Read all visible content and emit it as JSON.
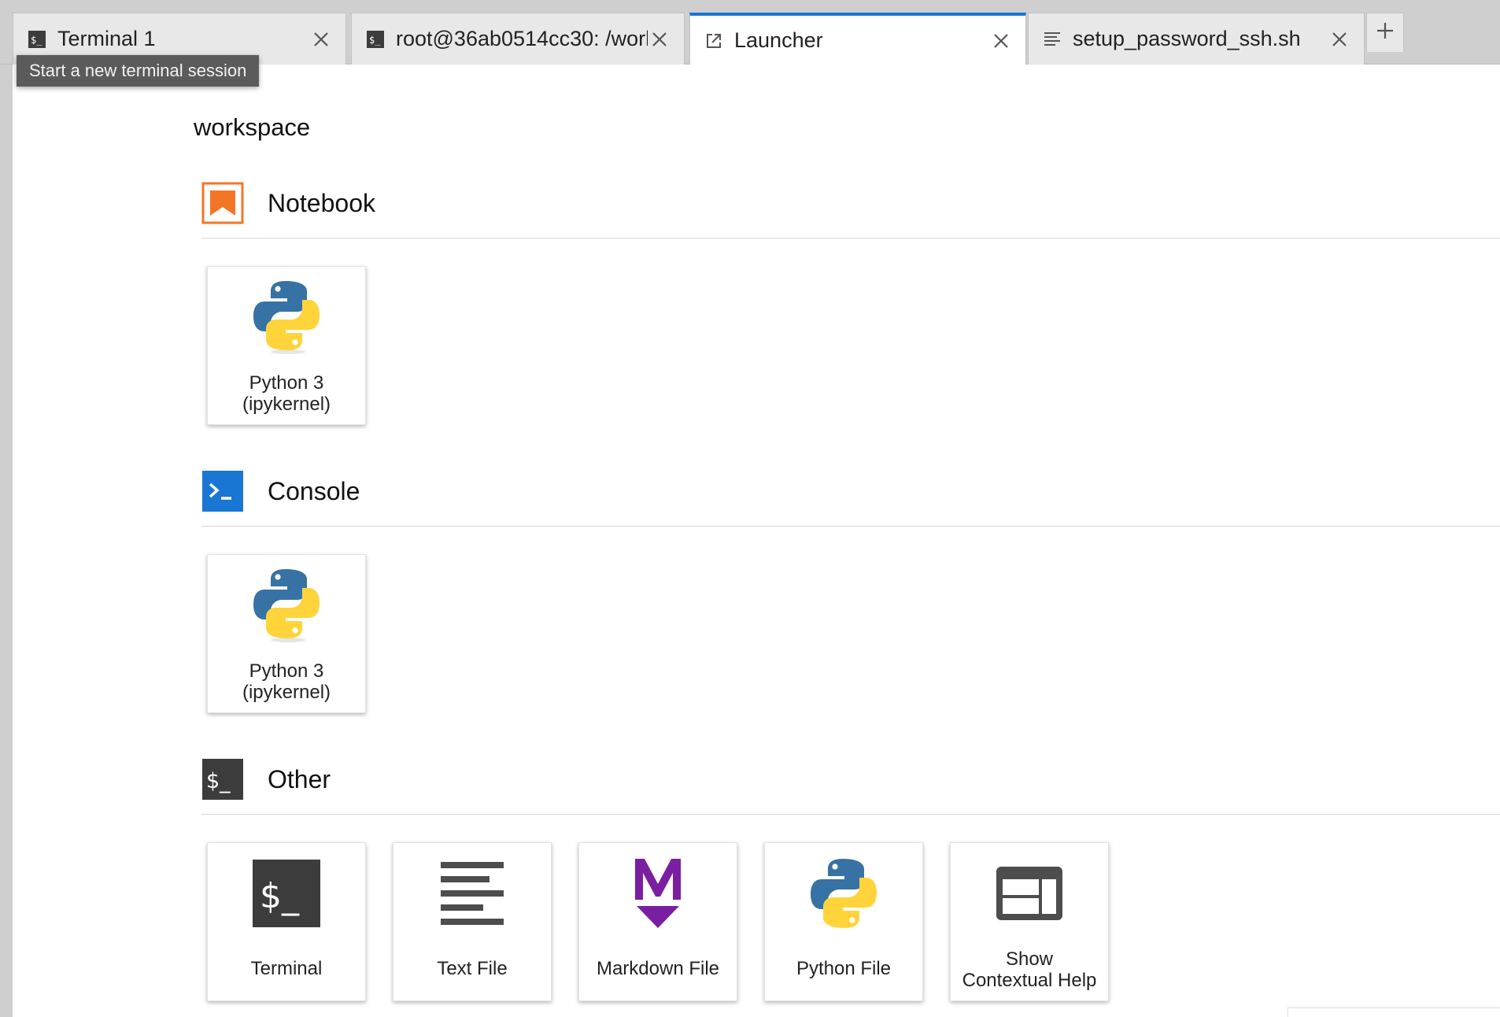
{
  "tabs": [
    {
      "label": "Terminal 1",
      "icon": "terminal-icon",
      "active": false
    },
    {
      "label": "root@36ab0514cc30: /worl",
      "icon": "terminal-icon",
      "active": false
    },
    {
      "label": "Launcher",
      "icon": "launch-icon",
      "active": true
    },
    {
      "label": "setup_password_ssh.sh",
      "icon": "text-file-icon",
      "active": false
    }
  ],
  "tooltip": "Start a new terminal session",
  "launcher": {
    "workspace": "workspace",
    "sections": {
      "notebook": {
        "title": "Notebook",
        "icon": "notebook-icon",
        "items": [
          {
            "label_line1": "Python 3",
            "label_line2": "(ipykernel)",
            "icon": "python-icon"
          }
        ]
      },
      "console": {
        "title": "Console",
        "icon": "console-icon",
        "items": [
          {
            "label_line1": "Python 3",
            "label_line2": "(ipykernel)",
            "icon": "python-icon"
          }
        ]
      },
      "other": {
        "title": "Other",
        "icon": "terminal-icon",
        "items": [
          {
            "label": "Terminal",
            "icon": "terminal-icon"
          },
          {
            "label": "Text File",
            "icon": "text-file-icon"
          },
          {
            "label": "Markdown File",
            "icon": "markdown-icon"
          },
          {
            "label": "Python File",
            "icon": "python-icon"
          },
          {
            "label_line1": "Show",
            "label_line2": "Contextual Help",
            "icon": "contextual-help-icon"
          }
        ]
      }
    }
  },
  "colors": {
    "active_tab_accent": "#1976d2",
    "notebook_orange": "#f37626",
    "console_blue": "#1976d2",
    "terminal_dark": "#3c3c3c",
    "markdown_purple": "#7b1fa2",
    "python_blue": "#3772a4",
    "python_yellow": "#ffd43b"
  }
}
